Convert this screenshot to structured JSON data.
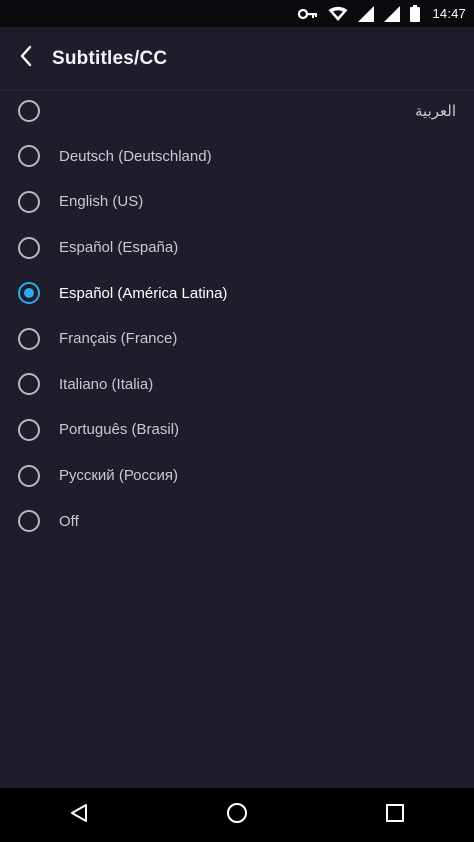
{
  "status_bar": {
    "time": "14:47",
    "icons": [
      "key-icon",
      "wifi-icon",
      "signal-icon",
      "signal-icon",
      "battery-icon"
    ]
  },
  "header": {
    "title": "Subtitles/CC",
    "back_icon": "back-arrow-icon"
  },
  "options": [
    {
      "label": "العربية",
      "selected": false
    },
    {
      "label": "Deutsch (Deutschland)",
      "selected": false
    },
    {
      "label": "English (US)",
      "selected": false
    },
    {
      "label": "Español (España)",
      "selected": false
    },
    {
      "label": "Español (América Latina)",
      "selected": true
    },
    {
      "label": "Français (France)",
      "selected": false
    },
    {
      "label": "Italiano (Italia)",
      "selected": false
    },
    {
      "label": "Português (Brasil)",
      "selected": false
    },
    {
      "label": "Русский (Россия)",
      "selected": false
    },
    {
      "label": "Off",
      "selected": false
    }
  ],
  "nav_bar": {
    "icons": [
      "back-triangle-icon",
      "home-circle-icon",
      "recents-square-icon"
    ]
  },
  "colors": {
    "background": "#1e1d2a",
    "accent": "#2ca9f2",
    "status_bar": "#0a0a0f",
    "nav_bar": "#000000"
  }
}
